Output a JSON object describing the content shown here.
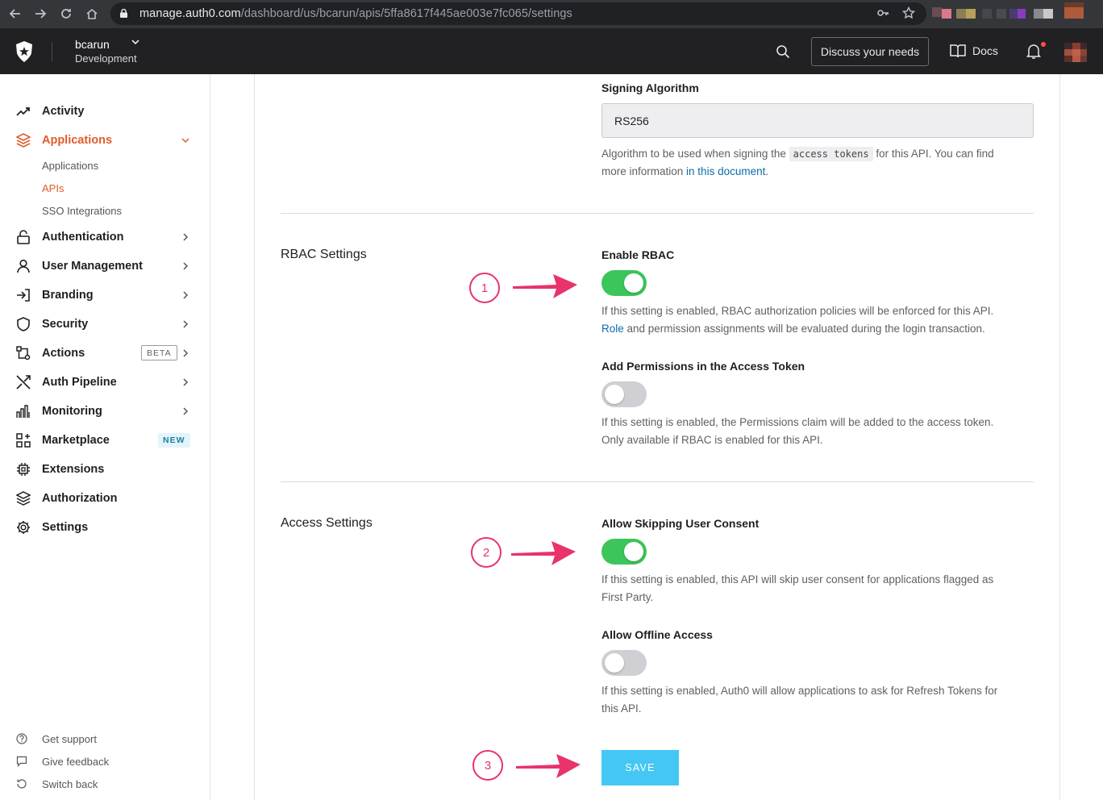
{
  "browser": {
    "url_domain": "manage.auth0.com",
    "url_path": "/dashboard/us/bcarun/apis/5ffa8617f445ae003e7fc065/settings"
  },
  "header": {
    "tenant_name": "bcarun",
    "tenant_env": "Development",
    "discuss_label": "Discuss your needs",
    "docs_label": "Docs"
  },
  "sidebar": {
    "items": [
      {
        "label": "Activity",
        "icon": "activity-icon"
      },
      {
        "label": "Applications",
        "icon": "layers-icon"
      },
      {
        "label": "Authentication",
        "icon": "lock-icon"
      },
      {
        "label": "User Management",
        "icon": "user-icon"
      },
      {
        "label": "Branding",
        "icon": "login-arrow-icon"
      },
      {
        "label": "Security",
        "icon": "shield-icon"
      },
      {
        "label": "Actions",
        "icon": "actions-icon",
        "badge": "BETA"
      },
      {
        "label": "Auth Pipeline",
        "icon": "shuffle-icon"
      },
      {
        "label": "Monitoring",
        "icon": "bar-chart-icon"
      },
      {
        "label": "Marketplace",
        "icon": "grid-plus-icon",
        "badge": "NEW"
      },
      {
        "label": "Extensions",
        "icon": "chip-icon"
      },
      {
        "label": "Authorization",
        "icon": "stack-icon"
      },
      {
        "label": "Settings",
        "icon": "gear-icon"
      }
    ],
    "sub_items": [
      "Applications",
      "APIs",
      "SSO Integrations"
    ],
    "footer": [
      "Get support",
      "Give feedback",
      "Switch back"
    ]
  },
  "main": {
    "signing": {
      "label": "Signing Algorithm",
      "value": "RS256",
      "help_before": "Algorithm to be used when signing the ",
      "help_code": "access tokens",
      "help_after": " for this API. You can find",
      "help_line2": "more information ",
      "help_link": "in this document",
      "help_end": "."
    },
    "rbac": {
      "title": "RBAC Settings",
      "enable_label": "Enable RBAC",
      "enable_on": true,
      "enable_help_1": "If this setting is enabled, RBAC authorization policies will be enforced for this API.",
      "enable_help_link": "Role",
      "enable_help_2": " and permission assignments will be evaluated during the login transaction.",
      "perm_label": "Add Permissions in the Access Token",
      "perm_on": false,
      "perm_help_1": "If this setting is enabled, the Permissions claim will be added to the access token.",
      "perm_help_2": "Only available if RBAC is enabled for this API."
    },
    "access": {
      "title": "Access Settings",
      "skip_label": "Allow Skipping User Consent",
      "skip_on": true,
      "skip_help_1": "If this setting is enabled, this API will skip user consent for applications flagged as",
      "skip_help_2": "First Party.",
      "offline_label": "Allow Offline Access",
      "offline_on": false,
      "offline_help_1": "If this setting is enabled, Auth0 will allow applications to ask for Refresh Tokens for",
      "offline_help_2": "this API."
    },
    "save_label": "SAVE"
  },
  "annotations": [
    "1",
    "2",
    "3"
  ],
  "colors": {
    "accent": "#e05b2b",
    "toggle_on": "#3bc55a",
    "save": "#44c7f4",
    "annotation": "#e8336b",
    "link": "#0a6ea8"
  }
}
